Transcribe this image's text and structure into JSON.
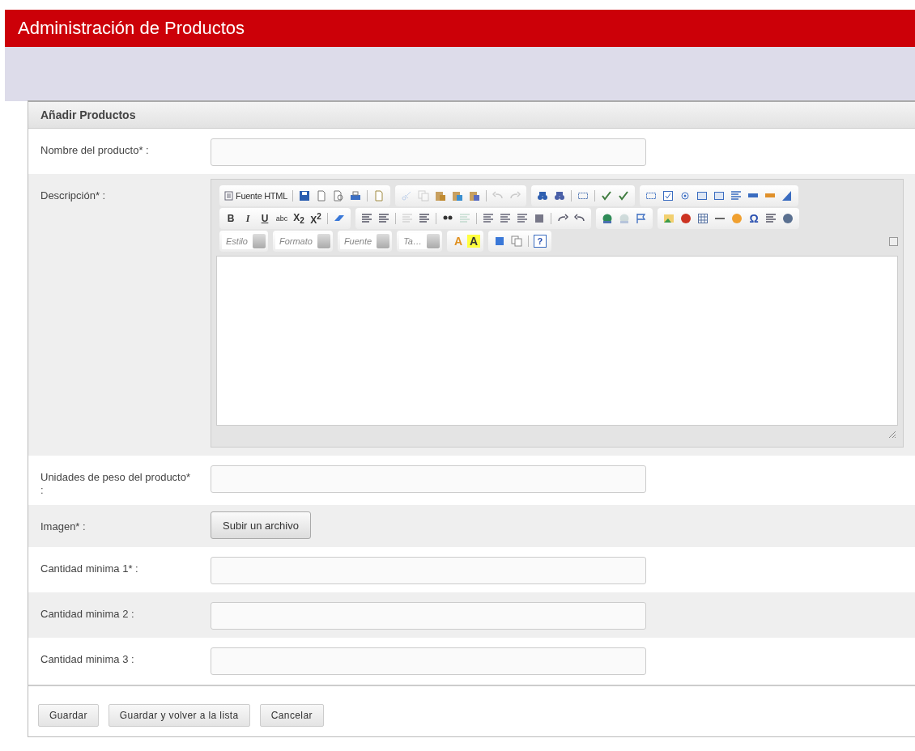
{
  "header": {
    "title": "Administración de Productos"
  },
  "panel": {
    "title": "Añadir Productos",
    "rows": [
      {
        "label": "Nombre del producto* :",
        "kind": "input"
      },
      {
        "label": "Descripción* :",
        "kind": "editor"
      },
      {
        "label": "Unidades de peso del producto* :",
        "kind": "input"
      },
      {
        "label": "Imagen* :",
        "kind": "upload",
        "button": "Subir un archivo"
      },
      {
        "label": "Cantidad minima 1* :",
        "kind": "input"
      },
      {
        "label": "Cantidad minima 2 :",
        "kind": "input"
      },
      {
        "label": "Cantidad minima 3 :",
        "kind": "input"
      }
    ]
  },
  "editor": {
    "toolbar": [
      [
        [
          {
            "kind": "labeled",
            "label": "Fuente HTML",
            "disabled": false
          },
          {
            "kind": "sep"
          },
          {
            "kind": "icon",
            "disabled": false
          },
          {
            "kind": "icon",
            "disabled": false
          },
          {
            "kind": "icon",
            "disabled": false
          },
          {
            "kind": "icon",
            "disabled": false
          },
          {
            "kind": "sep"
          },
          {
            "kind": "icon",
            "disabled": false
          }
        ],
        [
          {
            "kind": "icon",
            "disabled": true
          },
          {
            "kind": "icon",
            "disabled": true
          },
          {
            "kind": "icon",
            "disabled": false
          },
          {
            "kind": "icon",
            "disabled": false
          },
          {
            "kind": "icon",
            "disabled": false
          },
          {
            "kind": "sep"
          },
          {
            "kind": "icon",
            "disabled": true
          },
          {
            "kind": "icon",
            "disabled": true
          }
        ],
        [
          {
            "kind": "icon",
            "disabled": false
          },
          {
            "kind": "icon",
            "disabled": false
          },
          {
            "kind": "sep"
          },
          {
            "kind": "icon",
            "disabled": false
          },
          {
            "kind": "sep"
          },
          {
            "kind": "icon",
            "disabled": false
          },
          {
            "kind": "icon",
            "disabled": false
          }
        ],
        [
          {
            "kind": "icon",
            "disabled": false
          },
          {
            "kind": "icon",
            "disabled": false
          },
          {
            "kind": "icon",
            "disabled": false
          },
          {
            "kind": "icon",
            "disabled": false
          },
          {
            "kind": "icon",
            "disabled": false
          },
          {
            "kind": "icon",
            "disabled": false
          },
          {
            "kind": "icon",
            "disabled": false
          },
          {
            "kind": "icon",
            "disabled": false
          },
          {
            "kind": "icon",
            "disabled": false
          }
        ]
      ],
      [
        [
          {
            "kind": "text",
            "label": "B",
            "disabled": false
          },
          {
            "kind": "text",
            "label": "I",
            "disabled": false
          },
          {
            "kind": "text",
            "label": "U",
            "disabled": false
          },
          {
            "kind": "text",
            "label": "abc",
            "disabled": false
          },
          {
            "kind": "text",
            "label": "X$_{2}$",
            "disabled": false
          },
          {
            "kind": "text",
            "label": "X$^{2}$",
            "disabled": false
          },
          {
            "kind": "sep"
          },
          {
            "kind": "icon",
            "disabled": false
          }
        ],
        [
          {
            "kind": "icon",
            "disabled": false
          },
          {
            "kind": "icon",
            "disabled": false
          },
          {
            "kind": "sep"
          },
          {
            "kind": "icon",
            "disabled": true
          },
          {
            "kind": "icon",
            "disabled": false
          },
          {
            "kind": "sep"
          },
          {
            "kind": "icon",
            "disabled": false
          },
          {
            "kind": "icon",
            "disabled": true
          },
          {
            "kind": "sep"
          },
          {
            "kind": "icon",
            "disabled": false
          },
          {
            "kind": "icon",
            "disabled": false
          },
          {
            "kind": "icon",
            "disabled": false
          },
          {
            "kind": "icon",
            "disabled": false
          },
          {
            "kind": "sep"
          },
          {
            "kind": "icon",
            "disabled": false
          },
          {
            "kind": "icon",
            "disabled": false
          }
        ],
        [
          {
            "kind": "icon",
            "disabled": false
          },
          {
            "kind": "icon",
            "disabled": true
          },
          {
            "kind": "icon",
            "disabled": false
          }
        ],
        [
          {
            "kind": "icon",
            "disabled": false
          },
          {
            "kind": "icon",
            "disabled": false
          },
          {
            "kind": "icon",
            "disabled": false
          },
          {
            "kind": "icon",
            "disabled": false
          },
          {
            "kind": "icon",
            "disabled": false
          },
          {
            "kind": "glyph",
            "label": "Ω",
            "disabled": false
          },
          {
            "kind": "icon",
            "disabled": false
          },
          {
            "kind": "icon",
            "disabled": false
          }
        ]
      ],
      [
        [
          {
            "kind": "combo",
            "label": "Estilo"
          }
        ],
        [
          {
            "kind": "combo",
            "label": "Formato"
          }
        ],
        [
          {
            "kind": "combo",
            "label": "Fuente"
          }
        ],
        [
          {
            "kind": "combo",
            "label": "Ta…"
          }
        ],
        [
          {
            "kind": "fgcolor",
            "label": "A",
            "disabled": false
          },
          {
            "kind": "bgcolor",
            "label": "A",
            "disabled": false
          }
        ],
        [
          {
            "kind": "icon",
            "disabled": false
          },
          {
            "kind": "icon",
            "disabled": false
          },
          {
            "kind": "sep"
          },
          {
            "kind": "boxed",
            "label": "?",
            "disabled": false
          }
        ]
      ]
    ]
  },
  "buttons": [
    "Guardar",
    "Guardar y volver a la lista",
    "Cancelar"
  ]
}
